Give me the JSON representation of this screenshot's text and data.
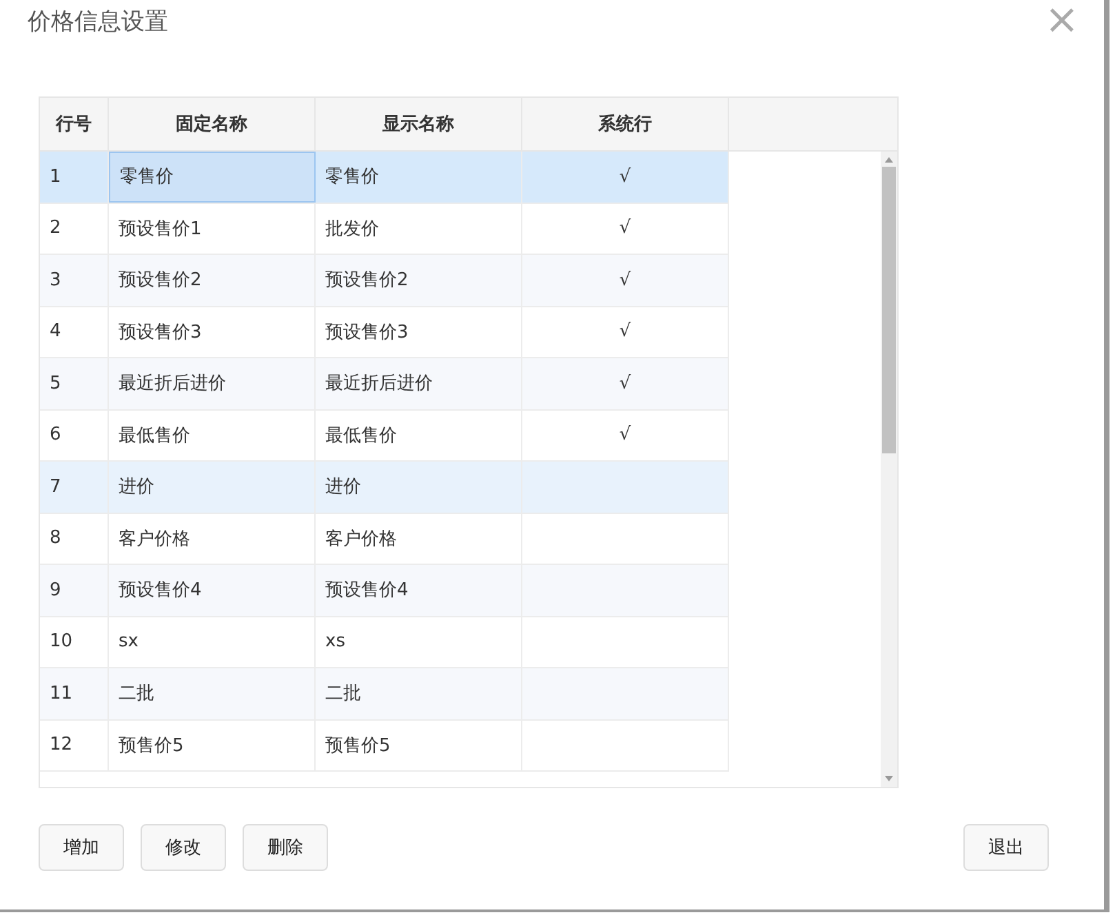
{
  "dialog": {
    "title": "价格信息设置",
    "close": "×"
  },
  "table": {
    "columns": [
      "行号",
      "固定名称",
      "显示名称",
      "系统行"
    ],
    "rows": [
      {
        "no": "1",
        "fixed": "零售价",
        "display": "零售价",
        "system": "√",
        "selected": true,
        "highlighted": false
      },
      {
        "no": "2",
        "fixed": "预设售价1",
        "display": "批发价",
        "system": "√",
        "selected": false,
        "highlighted": false
      },
      {
        "no": "3",
        "fixed": "预设售价2",
        "display": "预设售价2",
        "system": "√",
        "selected": false,
        "highlighted": false
      },
      {
        "no": "4",
        "fixed": "预设售价3",
        "display": "预设售价3",
        "system": "√",
        "selected": false,
        "highlighted": false
      },
      {
        "no": "5",
        "fixed": "最近折后进价",
        "display": "最近折后进价",
        "system": "√",
        "selected": false,
        "highlighted": false
      },
      {
        "no": "6",
        "fixed": "最低售价",
        "display": "最低售价",
        "system": "√",
        "selected": false,
        "highlighted": false
      },
      {
        "no": "7",
        "fixed": "进价",
        "display": "进价",
        "selected": false,
        "highlighted": true
      },
      {
        "no": "8",
        "fixed": "客户价格",
        "display": "客户价格",
        "selected": false,
        "highlighted": false
      },
      {
        "no": "9",
        "fixed": "预设售价4",
        "display": "预设售价4",
        "selected": false,
        "highlighted": false
      },
      {
        "no": "10",
        "fixed": "sx",
        "display": "xs",
        "selected": false,
        "highlighted": false
      },
      {
        "no": "11",
        "fixed": "二批",
        "display": "二批",
        "selected": false,
        "highlighted": false
      },
      {
        "no": "12",
        "fixed": "预售价5",
        "display": "预售价5",
        "selected": false,
        "highlighted": false
      }
    ]
  },
  "buttons_left": [
    "增加",
    "修改",
    "删除"
  ],
  "buttons_right": [
    "退出"
  ]
}
